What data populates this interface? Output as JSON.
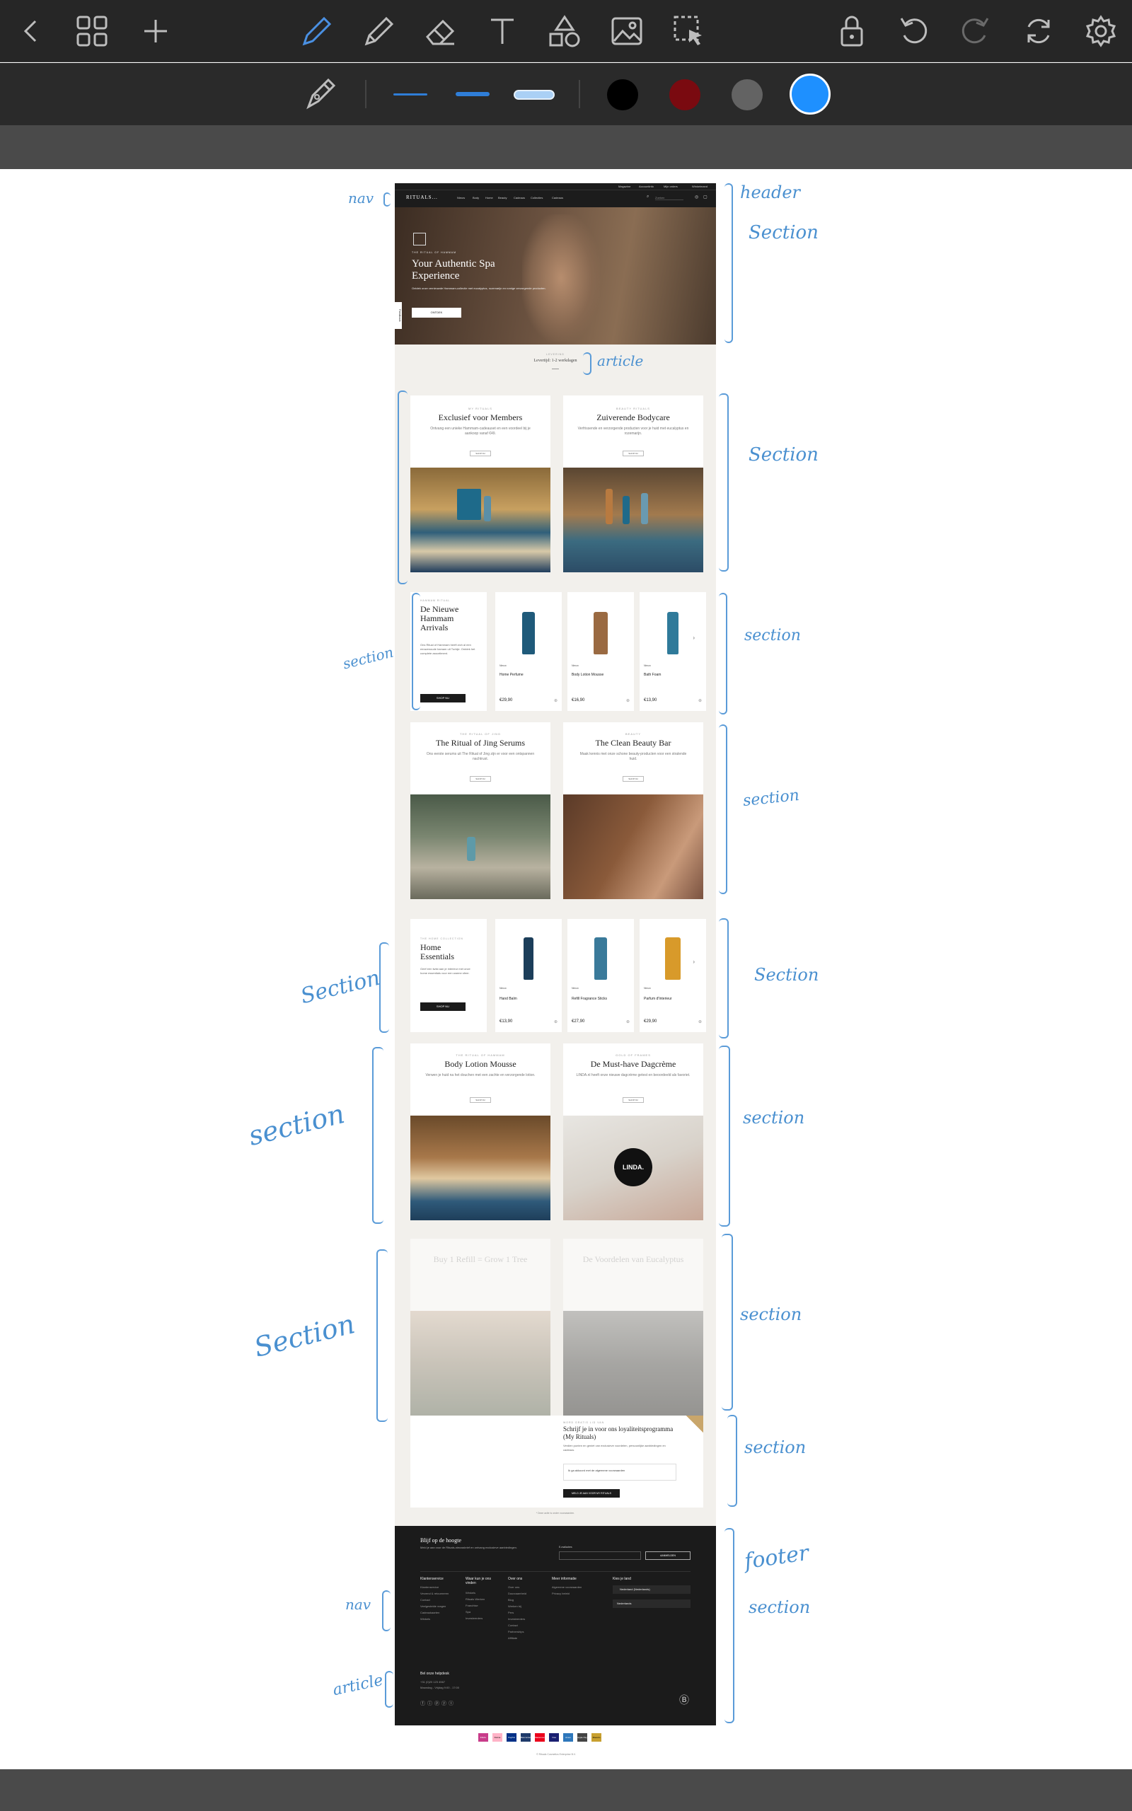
{
  "toolbar": {
    "tools": [
      "back-icon",
      "grid-icon",
      "plus-icon",
      "pen-icon",
      "pencil-icon",
      "eraser-icon",
      "text-icon",
      "shapes-icon",
      "image-icon",
      "lasso-select-icon",
      "lock-icon",
      "undo-icon",
      "redo-icon",
      "sync-icon",
      "settings-icon"
    ],
    "active_tool": "pen-icon",
    "accent": "#4a90e2"
  },
  "subbar": {
    "colors": [
      "#000000",
      "#7a0a10",
      "#636363",
      "#1e90ff"
    ],
    "selected_color": "#1e90ff"
  },
  "site": {
    "logo": "RITUALS...",
    "topbar_links": [
      "Magazine",
      "Accountinfo",
      "Mijn orders",
      "Winkelmand"
    ],
    "nav_links": [
      "Nieuw",
      "Body",
      "Home",
      "Beauty",
      "Cadeaus",
      "Collecties",
      "Cadeaus"
    ],
    "search_placeholder": "Zoeken",
    "hero": {
      "kicker": "THE RITUAL OF HAMMAM",
      "title": "Your Authentic Spa Experience",
      "subtitle": "Ontdek onze vernieuwde Hammam-collectie met eucalyptus, rozemarijn en romige verzorgende producten.",
      "button": "ONTDEK",
      "feedback_tab": "Feedback"
    },
    "promo": {
      "label": "LEVERING",
      "text": "Levertijd: 1-2 werkdagen"
    },
    "cards": [
      {
        "kicker": "MY RITUALS",
        "title": "Exclusief voor Members",
        "desc": "Ontvang een unieke Hammam-cadeauset en een voordeel bij je aankoop vanaf €49.",
        "btn": "SHOP NU"
      },
      {
        "kicker": "BEAUTY RITUALS",
        "title": "Zuiverende Bodycare",
        "desc": "Verfrissende en verzorgende producten voor je huid met eucalyptus en rozemarijn.",
        "btn": "SHOP NU"
      },
      {
        "kicker": "THE RITUAL OF JING",
        "title": "The Ritual of Jing Serums",
        "desc": "Ons eerste serums uit The Ritual of Jing zijn er voor een ontspannen nachtrust.",
        "btn": "SHOP NU"
      },
      {
        "kicker": "BEAUTY",
        "title": "The Clean Beauty Bar",
        "desc": "Maak kennis met onze schone beauty-producten voor een stralende huid.",
        "btn": "SHOP NU"
      },
      {
        "kicker": "THE RITUAL OF HAMMAM",
        "title": "Body Lotion Mousse",
        "desc": "Verwen je huid na het douchen met een zachte en verzorgende lotion.",
        "btn": "SHOP NU"
      },
      {
        "kicker": "GOLD OF FRAMES",
        "title": "De Must-have Dagcrème",
        "desc": "LINDA.nl heeft onze nieuwe dagcrème getest en beoordeeld als favoriet.",
        "btn": "SHOP NU"
      },
      {
        "kicker": "",
        "title": "Buy 1 Refill = Grow 1 Tree",
        "desc": "",
        "btn": ""
      },
      {
        "kicker": "",
        "title": "De Voordelen van Eucalyptus",
        "desc": "",
        "btn": ""
      }
    ],
    "hammam_feature": {
      "kicker": "HAMMAM RITUAL",
      "title": "De Nieuwe Hammam Arrivals",
      "desc": "Ons Ritual of Hammam heeft zich al een eeuwenoude hamam uit Turkije. Ontdek het complete assortiment.",
      "button": "SHOP NU",
      "products": [
        {
          "name": "Home Perfume",
          "price": "€29,90",
          "badge": "Nieuw"
        },
        {
          "name": "Body Lotion Mousse",
          "price": "€16,90",
          "badge": "Nieuw"
        },
        {
          "name": "Bath Foam",
          "price": "€13,90",
          "badge": "Nieuw"
        }
      ]
    },
    "home_feature": {
      "kicker": "THE HOME COLLECTION",
      "title": "Home Essentials",
      "desc": "Geef een twist aan je interieur met onze home essentials voor een warme sfeer.",
      "button": "SHOP NU",
      "products": [
        {
          "name": "Hand Balm",
          "price": "€13,90",
          "badge": "Nieuw"
        },
        {
          "name": "Refill Fragrance Sticks",
          "price": "€27,90",
          "badge": "Nieuw"
        },
        {
          "name": "Parfum d'Interieur",
          "price": "€29,90",
          "badge": "Nieuw"
        }
      ]
    },
    "loyalty": {
      "kicker": "WORD GRATIS LID VAN",
      "title": "Schrijf je in voor ons loyaliteitsprogramma (My Rituals)",
      "desc": "Verdien punten en geniet van exclusieve voordelen, persoonlijke aanbiedingen en cadeaus.",
      "checkbox_label": "Ik ga akkoord met de algemene voorwaarden",
      "button": "MELD JE AAN VOOR MY RITUALS"
    },
    "footnote": "* Deze actie is onder voorwaarden.",
    "footer": {
      "newsletter_title": "Blijf op de hoogte",
      "newsletter_text": "Meld je aan voor de Rituals-nieuwsbrief en ontvang exclusieve aanbiedingen.",
      "newsletter_label": "E-mailadres",
      "newsletter_button": "AANMELDEN",
      "columns": [
        {
          "title": "Klantenservice",
          "items": [
            "Klantenservice",
            "Verzend & retourneren",
            "Contact",
            "Veelgestelde vragen",
            "Cadeaukaarten",
            "Winkels"
          ]
        },
        {
          "title": "Waar kun je ons vinden",
          "items": [
            "Winkels",
            "Rituals Werken",
            "Franchise",
            "Spa",
            "Investeerders"
          ]
        },
        {
          "title": "Over ons",
          "items": [
            "Over ons",
            "Duurzaamheid",
            "Blog",
            "Werken bij",
            "Pers",
            "Investeerders",
            "Contact",
            "Partnerships",
            "Affiliate"
          ]
        },
        {
          "title": "Meer informatie",
          "items": [
            "Algemene voorwaarden",
            "Privacy beleid"
          ]
        },
        {
          "title": "Kies je land",
          "items": [
            "Nederland (Nederlands)",
            "Nederlands"
          ]
        }
      ],
      "service_title": "Bel onze helpdesk",
      "service_lines": [
        "+31 (0)20 123 4567",
        "Maandag - Vrijdag 9:00 - 17:00"
      ],
      "copyright": "© Rituals Cosmetics Enterprise B.V."
    },
    "payments": [
      "iDEAL",
      "Klarna",
      "PayPal",
      "Bancontact",
      "Mastercard",
      "Visa",
      "Amex",
      "Apple Pay",
      "Maestro"
    ]
  },
  "annotations": {
    "header": "header",
    "nav": "nav",
    "section": "Section",
    "section_lower": "section",
    "article": "article",
    "footer": "footer"
  }
}
